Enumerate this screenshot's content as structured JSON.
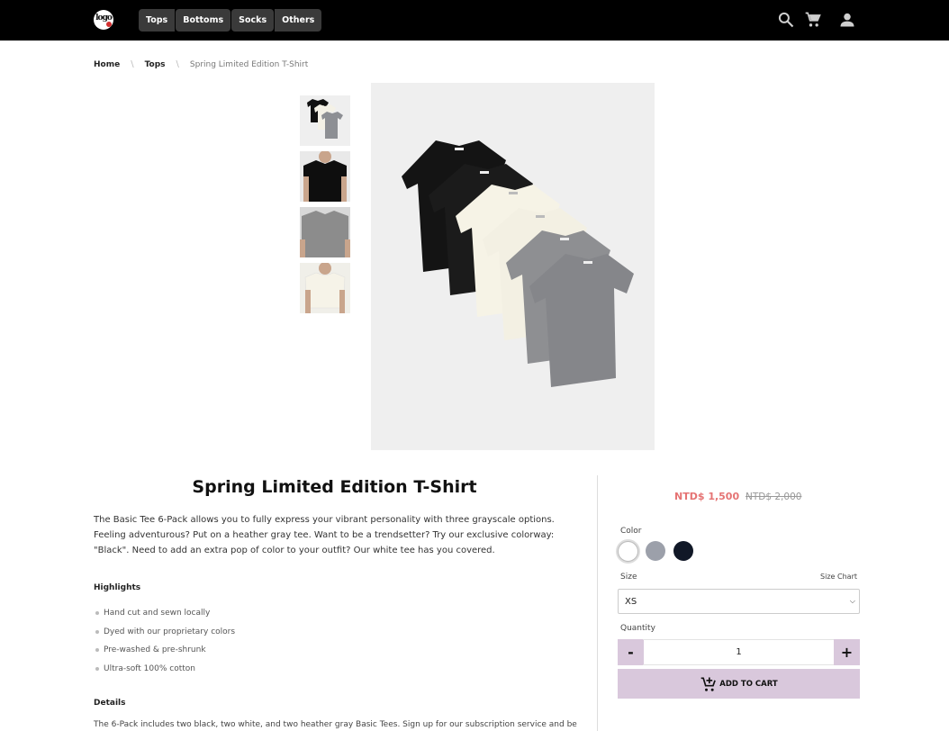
{
  "header": {
    "logo_text": "logo",
    "nav": [
      "Tops",
      "Bottoms",
      "Socks",
      "Others"
    ],
    "icons": [
      "search-icon",
      "cart-icon",
      "user-icon"
    ]
  },
  "breadcrumb": {
    "home": "Home",
    "category": "Tops",
    "current": "Spring Limited Edition T-Shirt"
  },
  "product": {
    "title": "Spring Limited Edition T-Shirt",
    "description": "The Basic Tee 6-Pack allows you to fully express your vibrant personality with three grayscale options. Feeling adventurous? Put on a heather gray tee. Want to be a trendsetter? Try our exclusive colorway: \"Black\". Need to add an extra pop of color to your outfit? Our white tee has you covered.",
    "highlights_heading": "Highlights",
    "highlights": [
      "Hand cut and sewn locally",
      "Dyed with our proprietary colors",
      "Pre-washed & pre-shrunk",
      "Ultra-soft 100% cotton"
    ],
    "details_heading": "Details",
    "details_text": "The 6-Pack includes two black, two white, and two heather gray Basic Tees. Sign up for our subscription service and be"
  },
  "purchase": {
    "price": "NTD$ 1,500",
    "original_price": "NTD$ 2,000",
    "color_label": "Color",
    "colors": [
      {
        "name": "white",
        "hex": "#ffffff",
        "selected": true
      },
      {
        "name": "gray",
        "hex": "#9ca0aa",
        "selected": false
      },
      {
        "name": "navy",
        "hex": "#111827",
        "selected": false
      }
    ],
    "size_label": "Size",
    "size_chart_label": "Size Chart",
    "size_value": "XS",
    "quantity_label": "Quantity",
    "quantity": "1",
    "minus_label": "-",
    "plus_label": "+",
    "add_to_cart_label": "ADD TO CART"
  },
  "colors": {
    "header_bg": "#000000",
    "accent_purple": "#d9c8dc",
    "price_red": "#e57373",
    "image_bg": "#efefef"
  }
}
